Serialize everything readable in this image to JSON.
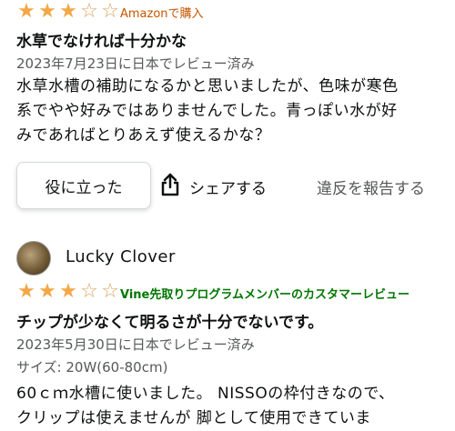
{
  "review1": {
    "rating": 3,
    "max_rating": 5,
    "source_label": "Amazonで購入",
    "title": "水草でなければ十分かな",
    "meta": "2023年7月23日に日本でレビュー済み",
    "body_lines": [
      "水草水槽の補助になるかと思いましたが、色味が寒色",
      "系でやや好みではありませんでした。青っぽい水が好",
      "みであればとりあえず使えるかな？"
    ],
    "helpful_label": "役に立った",
    "share_label": "シェアする",
    "report_label": "違反を報告する"
  },
  "review2": {
    "username": "Lucky Clover",
    "rating": 3,
    "max_rating": 5,
    "source_label": "Vine先取りプログラムメンバーのカスタマーレビュー",
    "title": "チップが少なくて明るさが十分でないです。",
    "meta": "2023年5月30日に日本でレビュー済み",
    "size_info": "サイズ: 20W(60-80cm)",
    "body_lines": [
      "60ｃｍ水槽に使いました。 NISSOの枠付きなので、",
      "クリップは使えませんが 脚として使用できていま"
    ]
  },
  "colors": {
    "star": "#f3a847",
    "amazon_tag": "#c45500",
    "vine_tag": "#007600",
    "meta_text": "#565959"
  },
  "icons": {
    "share": "share-icon",
    "star_full": "star-full-icon",
    "star_empty": "star-empty-icon"
  }
}
